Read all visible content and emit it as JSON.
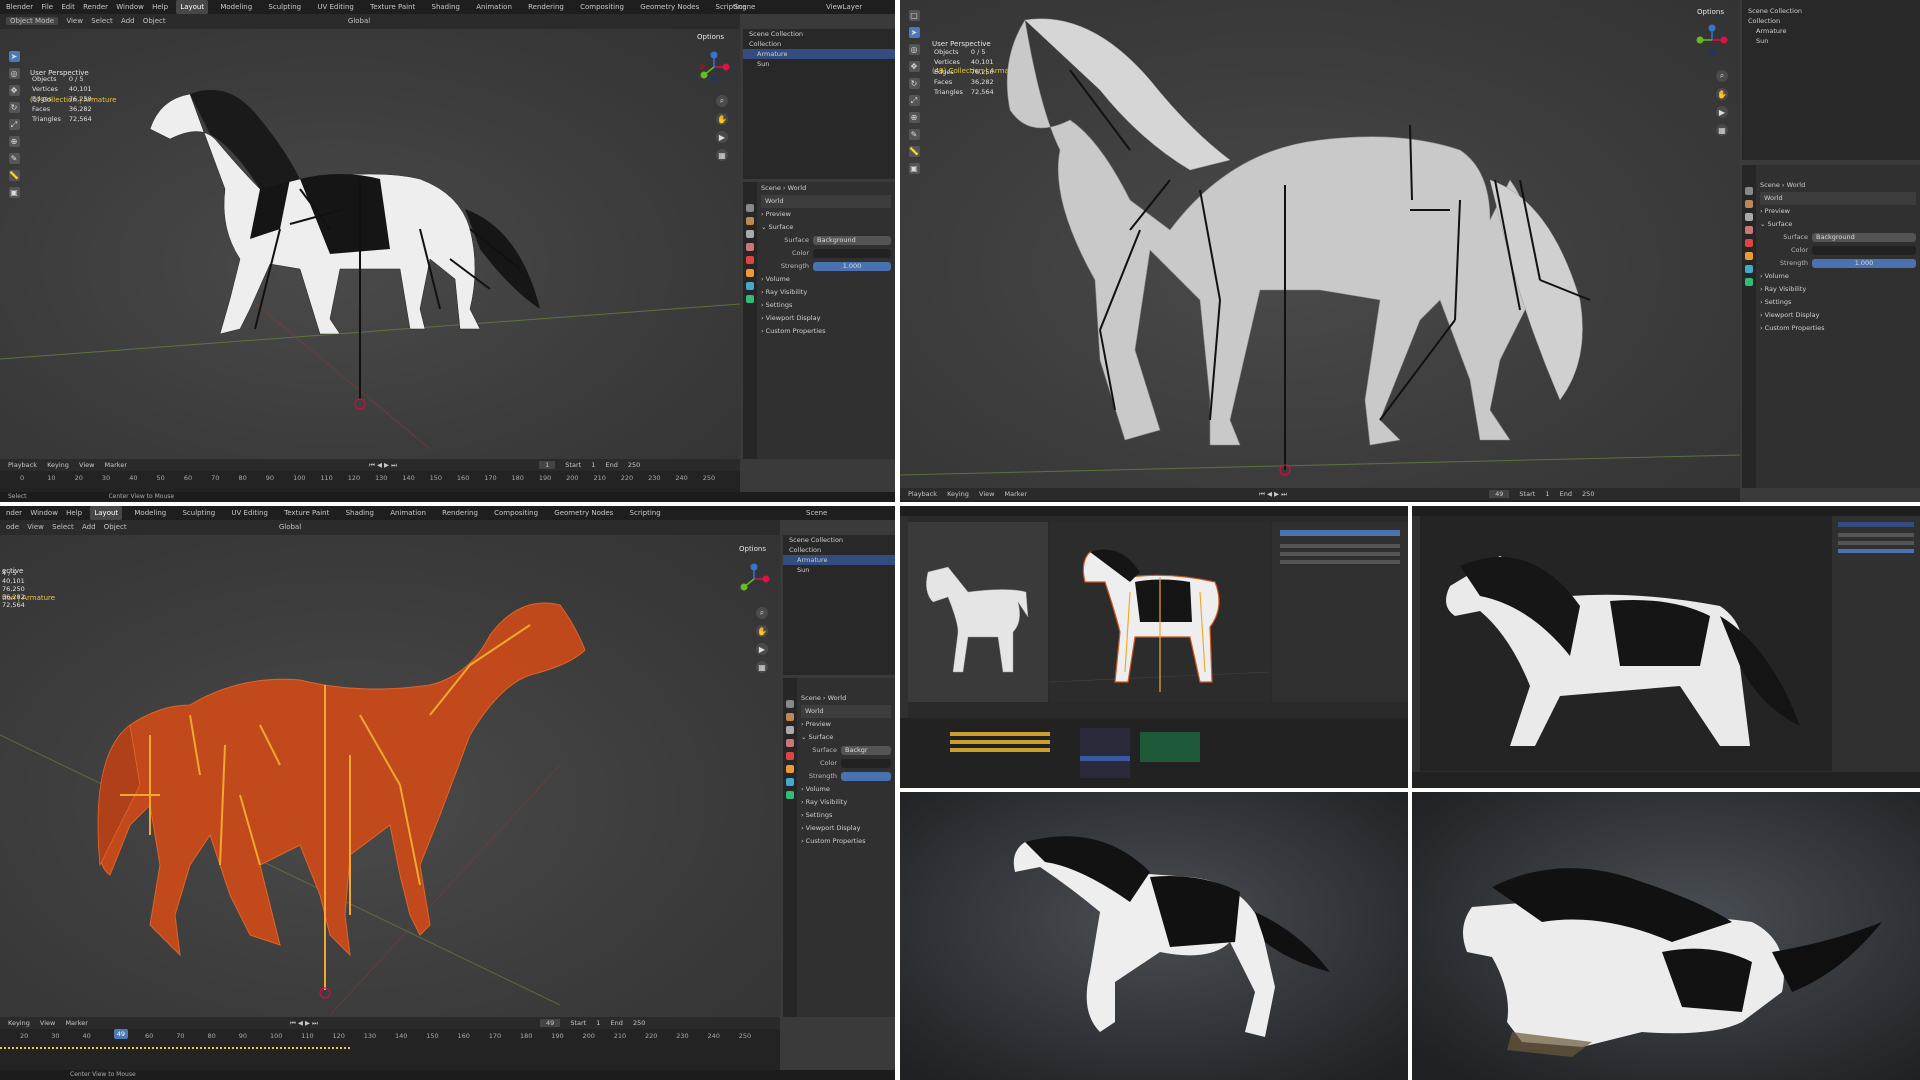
{
  "collage": {
    "panel_a": {
      "app_title": "Blender",
      "menu": [
        "File",
        "Edit",
        "Render",
        "Window",
        "Help"
      ],
      "workspaces": [
        "Layout",
        "Modeling",
        "Sculpting",
        "UV Editing",
        "Texture Paint",
        "Shading",
        "Animation",
        "Rendering",
        "Compositing",
        "Geometry Nodes",
        "Scripting"
      ],
      "mode": "Object Mode",
      "header_menu": [
        "View",
        "Select",
        "Add",
        "Object"
      ],
      "orientation": "Global",
      "scene_label": "Scene",
      "viewlayer_label": "ViewLayer",
      "options_label": "Options",
      "view_name": "User Perspective",
      "collection_path": "(1) Collection | Armature",
      "stats": [
        {
          "k": "Objects",
          "v": "0 / 5"
        },
        {
          "k": "Vertices",
          "v": "40,101"
        },
        {
          "k": "Edges",
          "v": "76,250"
        },
        {
          "k": "Faces",
          "v": "36,282"
        },
        {
          "k": "Triangles",
          "v": "72,564"
        }
      ],
      "outliner": [
        "Scene Collection",
        "Collection",
        "Armature",
        "Sun"
      ],
      "props": {
        "breadcrumb_scene": "Scene",
        "breadcrumb_world": "World",
        "world_name": "World",
        "sections": [
          "Preview",
          "Surface"
        ],
        "surface_label": "Surface",
        "surface_value": "Background",
        "color_label": "Color",
        "strength_label": "Strength",
        "strength_value": "1.000",
        "more_sections": [
          "Volume",
          "Ray Visibility",
          "Settings",
          "Viewport Display",
          "Custom Properties"
        ]
      },
      "timeline": {
        "menu": [
          "Playback",
          "Keying",
          "View",
          "Marker"
        ],
        "current_frame": "1",
        "start_label": "Start",
        "start_value": "1",
        "end_label": "End",
        "end_value": "250",
        "ruler": [
          "0",
          "10",
          "20",
          "30",
          "40",
          "50",
          "60",
          "70",
          "80",
          "90",
          "100",
          "110",
          "120",
          "130",
          "140",
          "150",
          "160",
          "170",
          "180",
          "190",
          "200",
          "210",
          "220",
          "230",
          "240",
          "250"
        ]
      },
      "status": [
        "Select",
        "Center View to Mouse"
      ]
    },
    "panel_b": {
      "view_name": "User Perspective",
      "collection_path": "(49) Collection | Armature",
      "stats": [
        {
          "k": "Objects",
          "v": "0 / 5"
        },
        {
          "k": "Vertices",
          "v": "40,101"
        },
        {
          "k": "Edges",
          "v": "76,250"
        },
        {
          "k": "Faces",
          "v": "36,282"
        },
        {
          "k": "Triangles",
          "v": "72,564"
        }
      ],
      "options_label": "Options",
      "outliner": [
        "Scene Collection",
        "Collection",
        "Armature",
        "Sun"
      ],
      "props": {
        "breadcrumb_scene": "Scene",
        "breadcrumb_world": "World",
        "world_name": "World",
        "sections": [
          "Preview",
          "Surface"
        ],
        "surface_label": "Surface",
        "surface_value": "Background",
        "color_label": "Color",
        "strength_label": "Strength",
        "strength_value": "1.000",
        "more_sections": [
          "Volume",
          "Ray Visibility",
          "Settings",
          "Viewport Display",
          "Custom Properties"
        ]
      },
      "timeline": {
        "menu": [
          "Playback",
          "Keying",
          "View",
          "Marker"
        ],
        "current_frame": "49",
        "start_label": "Start",
        "start_value": "1",
        "end_label": "End",
        "end_value": "250"
      }
    },
    "panel_c": {
      "menu": [
        "nder",
        "Window",
        "Help"
      ],
      "workspaces": [
        "Layout",
        "Modeling",
        "Sculpting",
        "UV Editing",
        "Texture Paint",
        "Shading",
        "Animation",
        "Rendering",
        "Compositing",
        "Geometry Nodes",
        "Scripting"
      ],
      "header_menu": [
        "ode",
        "View",
        "Select",
        "Add",
        "Object"
      ],
      "orientation": "Global",
      "scene_label": "Scene",
      "view_name": "ective",
      "collection_path": "tion | Armature",
      "stats": [
        "4 / 5",
        "40,101",
        "76,250",
        "36,282",
        "72,564"
      ],
      "options_label": "Options",
      "outliner": [
        "Scene Collection",
        "Collection",
        "Armature",
        "Sun"
      ],
      "props": {
        "breadcrumb_scene": "Scene",
        "breadcrumb_world": "World",
        "world_name": "World",
        "sections": [
          "Preview",
          "Surface"
        ],
        "surface_label": "Surface",
        "surface_value": "Backgr",
        "color_label": "Color",
        "strength_label": "Strength",
        "more_sections": [
          "Volume",
          "Ray Visibility",
          "Settings",
          "Viewport Display",
          "Custom Properties"
        ]
      },
      "timeline": {
        "menu": [
          "Keying",
          "View",
          "Marker"
        ],
        "current_frame": "49",
        "start_label": "Start",
        "start_value": "1",
        "end_label": "End",
        "end_value": "250",
        "ruler": [
          "20",
          "30",
          "40",
          "49",
          "60",
          "70",
          "80",
          "90",
          "100",
          "110",
          "120",
          "130",
          "140",
          "150",
          "160",
          "170",
          "180",
          "190",
          "200",
          "210",
          "220",
          "230",
          "240",
          "250"
        ]
      },
      "status": [
        "Center View to Mouse"
      ]
    }
  },
  "colors": {
    "accent": "#4a7ab8",
    "armature_dark": "#111111",
    "armature_orange": "#f0a830",
    "wire_orange": "#d2561e",
    "selection_text": "#e8c53a"
  }
}
